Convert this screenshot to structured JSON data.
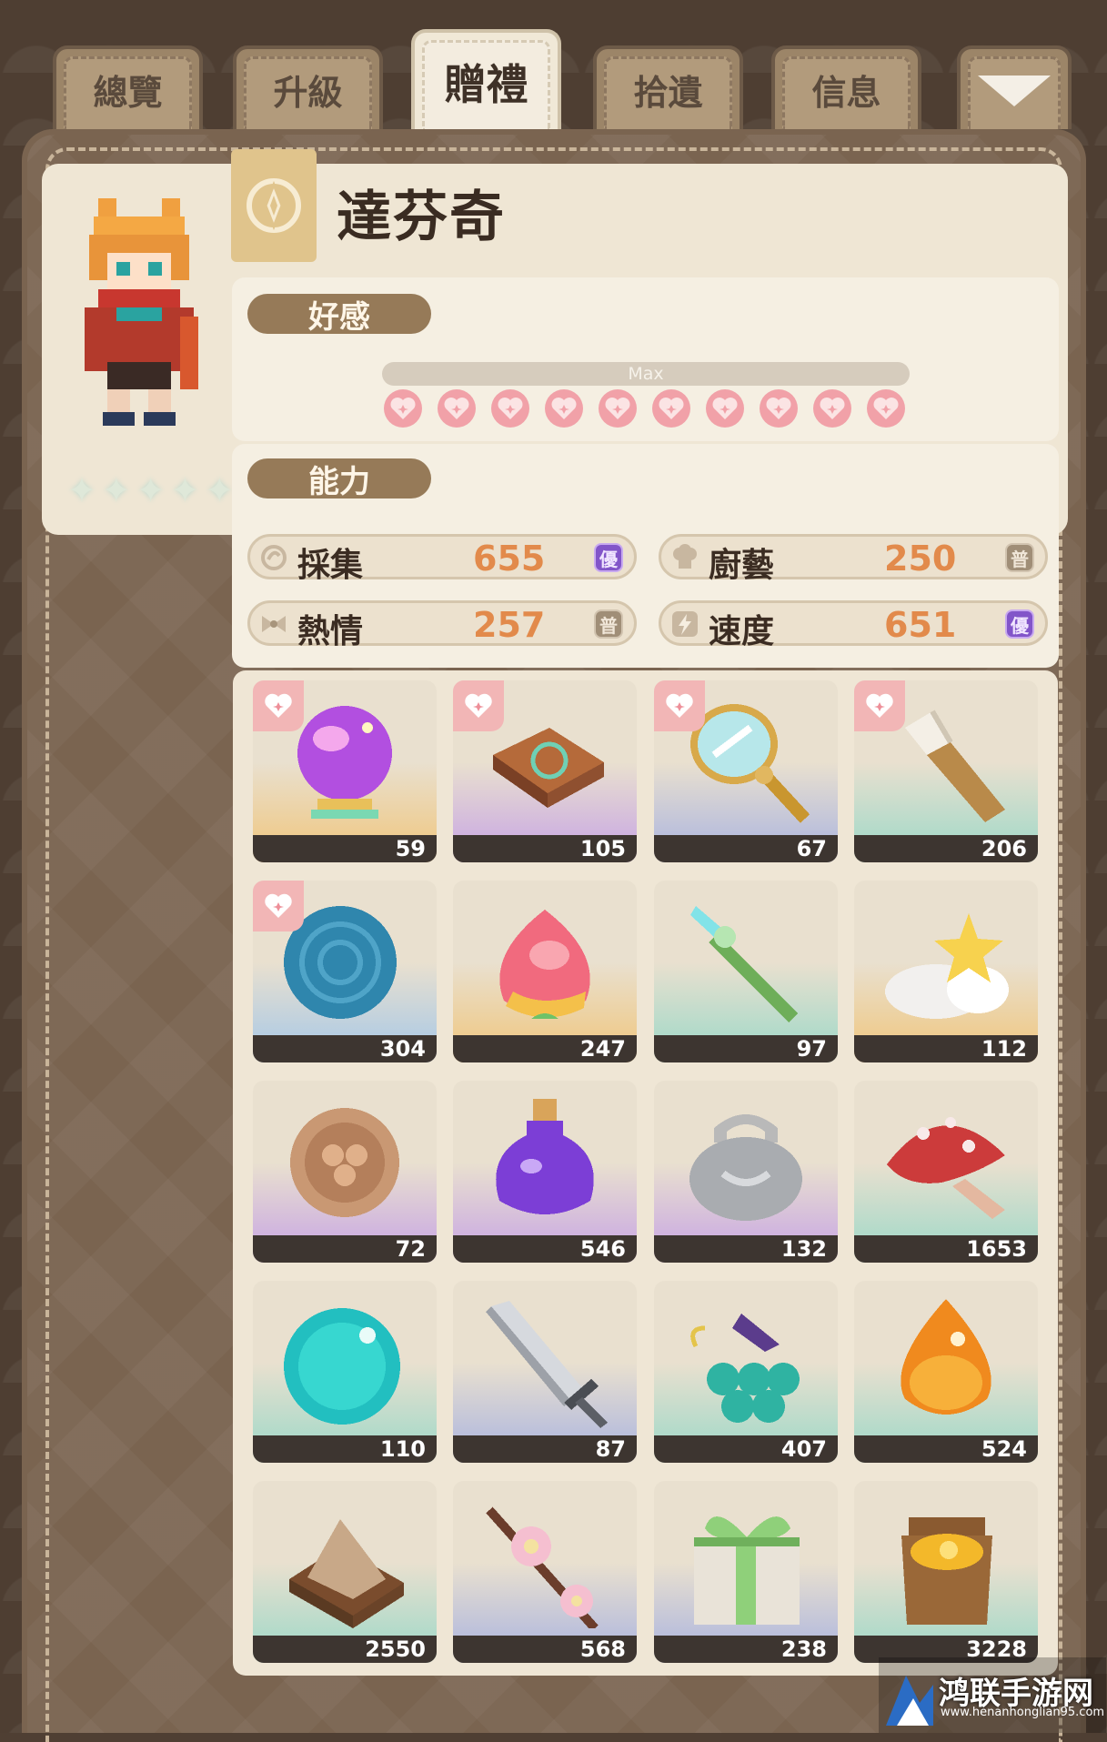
{
  "tabs": [
    {
      "label": "總覽",
      "active": false
    },
    {
      "label": "升級",
      "active": false
    },
    {
      "label": "贈禮",
      "active": true
    },
    {
      "label": "拾遺",
      "active": false
    },
    {
      "label": "信息",
      "active": false
    }
  ],
  "dropdown_icon": "triangle-down-icon",
  "character": {
    "name": "達芬奇",
    "stars": "✦✦✦✦✦",
    "emblem_icon": "diamond-star-emblem-icon"
  },
  "affinity": {
    "label": "好感",
    "bar_text": "Max",
    "hearts_filled": 10,
    "hearts_total": 10
  },
  "ability": {
    "label": "能力",
    "stats": [
      {
        "name": "採集",
        "value": "655",
        "grade": "優",
        "grade_color": "#8255c9",
        "icon": "gather-icon"
      },
      {
        "name": "廚藝",
        "value": "250",
        "grade": "普",
        "grade_color": "#a08e77",
        "icon": "chef-hat-icon"
      },
      {
        "name": "熱情",
        "value": "257",
        "grade": "普",
        "grade_color": "#a08e77",
        "icon": "bow-icon"
      },
      {
        "name": "速度",
        "value": "651",
        "grade": "優",
        "grade_color": "#8255c9",
        "icon": "lightning-icon"
      }
    ]
  },
  "gifts": [
    {
      "item": "crystal-ball",
      "count": "59",
      "favorite": true
    },
    {
      "item": "ancient-book",
      "count": "105",
      "favorite": true
    },
    {
      "item": "hand-mirror",
      "count": "67",
      "favorite": true
    },
    {
      "item": "paint-brush",
      "count": "206",
      "favorite": true
    },
    {
      "item": "yarn-ball",
      "count": "304",
      "favorite": true
    },
    {
      "item": "peach",
      "count": "247",
      "favorite": false
    },
    {
      "item": "jade-staff",
      "count": "97",
      "favorite": false
    },
    {
      "item": "star-cloud",
      "count": "112",
      "favorite": false
    },
    {
      "item": "wooden-coin",
      "count": "72",
      "favorite": false
    },
    {
      "item": "purple-potion",
      "count": "546",
      "favorite": false
    },
    {
      "item": "silver-lock",
      "count": "132",
      "favorite": false
    },
    {
      "item": "red-mushroom",
      "count": "1653",
      "favorite": false
    },
    {
      "item": "teal-gem",
      "count": "110",
      "favorite": false
    },
    {
      "item": "steel-sword",
      "count": "87",
      "favorite": false
    },
    {
      "item": "grapes",
      "count": "407",
      "favorite": false
    },
    {
      "item": "amber-drop",
      "count": "524",
      "favorite": false
    },
    {
      "item": "sand-box",
      "count": "2550",
      "favorite": false
    },
    {
      "item": "cherry-blossom",
      "count": "568",
      "favorite": false
    },
    {
      "item": "gift-box",
      "count": "238",
      "favorite": false
    },
    {
      "item": "honey-jar",
      "count": "3228",
      "favorite": false
    }
  ],
  "watermark": {
    "text": "鸿联手游网",
    "url": "www.henanhonglian95.com"
  }
}
